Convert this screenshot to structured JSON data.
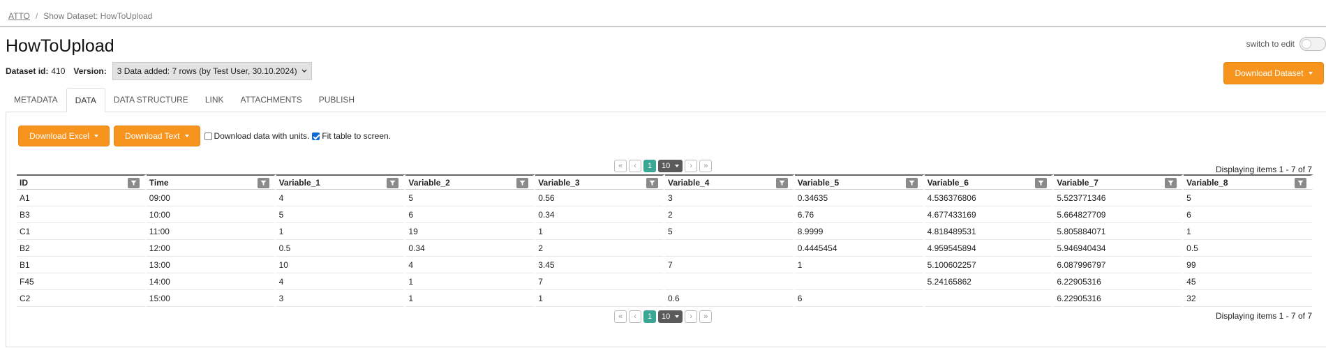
{
  "breadcrumb": {
    "root": "ATTO",
    "current": "Show Dataset: HowToUpload"
  },
  "title": "HowToUpload",
  "switch_label": "switch to edit",
  "dataset": {
    "id_label": "Dataset id:",
    "id_value": "410",
    "version_label": "Version:",
    "version_value": "3 Data added: 7 rows (by Test User, 30.10.2024)"
  },
  "download_dataset_label": "Download Dataset",
  "tabs": [
    {
      "label": "METADATA"
    },
    {
      "label": "DATA"
    },
    {
      "label": "DATA STRUCTURE"
    },
    {
      "label": "LINK"
    },
    {
      "label": "ATTACHMENTS"
    },
    {
      "label": "PUBLISH"
    }
  ],
  "active_tab": "DATA",
  "toolbar": {
    "download_excel": "Download Excel",
    "download_text": "Download Text",
    "units_label": "Download data with units.",
    "units_checked": false,
    "fit_label": "Fit table to screen.",
    "fit_checked": true
  },
  "pager": {
    "first": "«",
    "prev": "‹",
    "current_page": "1",
    "page_size": "10",
    "next": "›",
    "last": "»"
  },
  "display_info": "Displaying items 1 - 7 of 7",
  "grid": {
    "columns": [
      "ID",
      "Time",
      "Variable_1",
      "Variable_2",
      "Variable_3",
      "Variable_4",
      "Variable_5",
      "Variable_6",
      "Variable_7",
      "Variable_8"
    ],
    "rows": [
      [
        "A1",
        "09:00",
        "4",
        "5",
        "0.56",
        "3",
        "0.34635",
        "4.536376806",
        "5.523771346",
        "5"
      ],
      [
        "B3",
        "10:00",
        "5",
        "6",
        "0.34",
        "2",
        "6.76",
        "4.677433169",
        "5.664827709",
        "6"
      ],
      [
        "C1",
        "11:00",
        "1",
        "19",
        "1",
        "5",
        "8.9999",
        "4.818489531",
        "5.805884071",
        "1"
      ],
      [
        "B2",
        "12:00",
        "0.5",
        "0.34",
        "2",
        "",
        "0.4445454",
        "4.959545894",
        "5.946940434",
        "0.5"
      ],
      [
        "B1",
        "13:00",
        "10",
        "4",
        "3.45",
        "7",
        "1",
        "5.100602257",
        "6.087996797",
        "99"
      ],
      [
        "F45",
        "14:00",
        "4",
        "1",
        "7",
        "",
        "",
        "5.24165862",
        "6.22905316",
        "45"
      ],
      [
        "C2",
        "15:00",
        "3",
        "1",
        "1",
        "0.6",
        "6",
        "",
        "6.22905316",
        "32"
      ]
    ]
  },
  "colors": {
    "accent_orange": "#f7941d",
    "pager_active": "#3aa795"
  }
}
